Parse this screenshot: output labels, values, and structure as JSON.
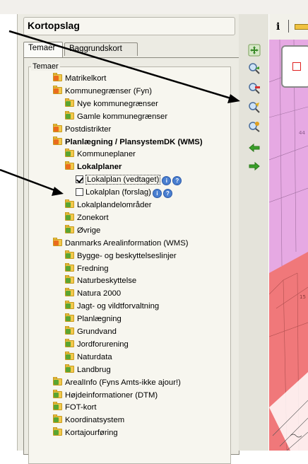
{
  "panel": {
    "title": "Kortopslag",
    "tabs": [
      "Temaer",
      "Baggrundskort"
    ],
    "group_legend": "Temaer"
  },
  "tree": [
    {
      "label": "Matrikelkort",
      "level": 1,
      "icon": "orange"
    },
    {
      "label": "Kommunegrænser (Fyn)",
      "level": 1,
      "icon": "orange"
    },
    {
      "label": "Nye kommunegrænser",
      "level": 2,
      "icon": "green"
    },
    {
      "label": "Gamle kommunegrænser",
      "level": 2,
      "icon": "green"
    },
    {
      "label": "Postdistrikter",
      "level": 1,
      "icon": "orange"
    },
    {
      "label": "Planlægning / PlansystemDK (WMS)",
      "level": 1,
      "icon": "orange",
      "bold": true
    },
    {
      "label": "Kommuneplaner",
      "level": 2,
      "icon": "green"
    },
    {
      "label": "Lokalplaner",
      "level": 2,
      "icon": "orange",
      "bold": true
    },
    {
      "label": "Lokalplan (vedtaget)",
      "level": 3,
      "checkbox": true,
      "checked": true,
      "info": true,
      "focused": true
    },
    {
      "label": "Lokalplan (forslag)",
      "level": 3,
      "checkbox": true,
      "checked": false,
      "info": true
    },
    {
      "label": "Lokalplandelområder",
      "level": 2,
      "icon": "green"
    },
    {
      "label": "Zonekort",
      "level": 2,
      "icon": "green"
    },
    {
      "label": "Øvrige",
      "level": 2,
      "icon": "green"
    },
    {
      "label": "Danmarks Arealinformation (WMS)",
      "level": 1,
      "icon": "orange"
    },
    {
      "label": "Bygge- og beskyttelseslinjer",
      "level": 2,
      "icon": "green"
    },
    {
      "label": "Fredning",
      "level": 2,
      "icon": "green"
    },
    {
      "label": "Naturbeskyttelse",
      "level": 2,
      "icon": "green"
    },
    {
      "label": "Natura 2000",
      "level": 2,
      "icon": "green"
    },
    {
      "label": "Jagt- og vildtforvaltning",
      "level": 2,
      "icon": "green"
    },
    {
      "label": "Planlægning",
      "level": 2,
      "icon": "green"
    },
    {
      "label": "Grundvand",
      "level": 2,
      "icon": "green"
    },
    {
      "label": "Jordforurening",
      "level": 2,
      "icon": "green"
    },
    {
      "label": "Naturdata",
      "level": 2,
      "icon": "green"
    },
    {
      "label": "Landbrug",
      "level": 2,
      "icon": "green"
    },
    {
      "label": "ArealInfo (Fyns Amts-ikke ajour!)",
      "level": 1,
      "icon": "green"
    },
    {
      "label": "Højdeinformationer (DTM)",
      "level": 1,
      "icon": "green"
    },
    {
      "label": "FOT-kort",
      "level": 1,
      "icon": "green"
    },
    {
      "label": "Koordinatsystem",
      "level": 1,
      "icon": "green"
    },
    {
      "label": "Kortajourføring",
      "level": 1,
      "icon": "green"
    }
  ],
  "map_toolbar": {
    "info_label": "i"
  },
  "tools": [
    "pan-icon",
    "zoom-in-icon",
    "zoom-out-icon",
    "zoom-extent-icon",
    "zoom-previous-icon",
    "back-arrow-icon",
    "forward-arrow-icon"
  ],
  "map": {
    "label_a": "15",
    "label_b": "44"
  },
  "colors": {
    "map_pink": "#e6a9e3",
    "map_red": "#f0787a",
    "panel_bg": "#ecebe3"
  }
}
